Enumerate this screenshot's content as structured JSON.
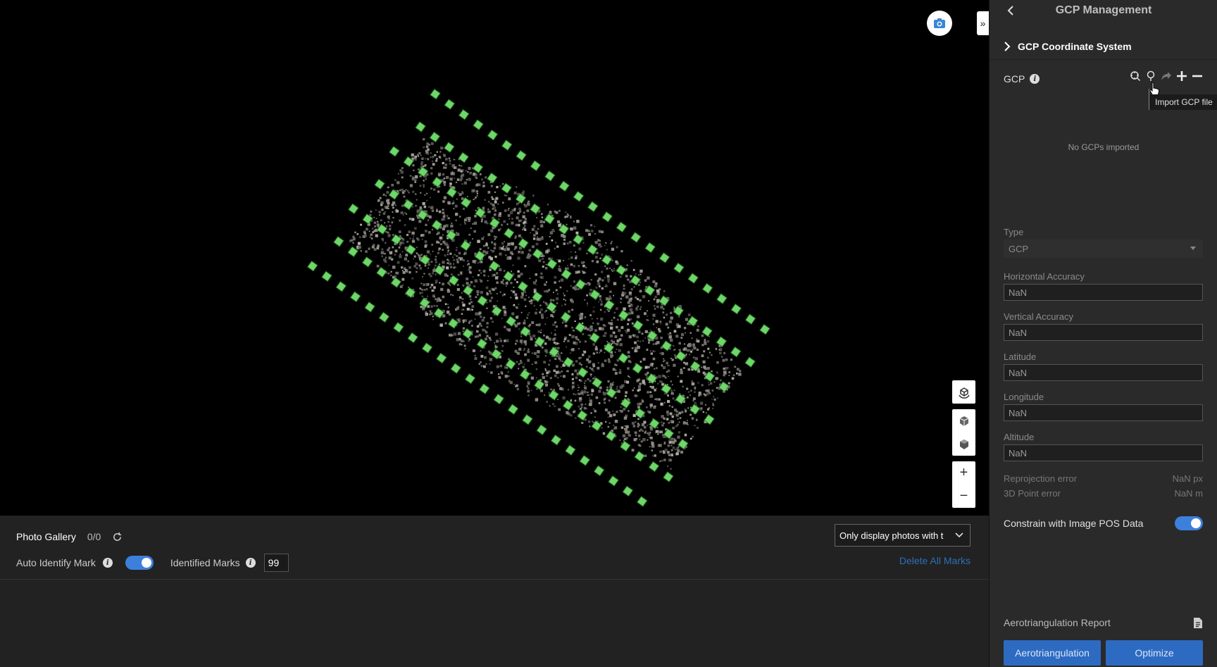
{
  "panel": {
    "title": "GCP Management",
    "coord_section": "GCP Coordinate System",
    "gcp_label": "GCP",
    "tooltip": "Import GCP file",
    "empty_text": "No GCPs imported",
    "type_label": "Type",
    "type_value": "GCP",
    "fields": [
      {
        "label": "Horizontal Accuracy",
        "value": "NaN"
      },
      {
        "label": "Vertical Accuracy",
        "value": "NaN"
      },
      {
        "label": "Latitude",
        "value": "NaN"
      },
      {
        "label": "Longitude",
        "value": "NaN"
      },
      {
        "label": "Altitude",
        "value": "NaN"
      }
    ],
    "reprojection_label": "Reprojection error",
    "reprojection_value": "NaN px",
    "point_error_label": "3D Point error",
    "point_error_value": "NaN m",
    "constrain_label": "Constrain with Image POS Data",
    "constrain_on": true,
    "report_label": "Aerotriangulation Report",
    "aerotriangulation_button": "Aerotriangulation",
    "optimize_button": "Optimize"
  },
  "bottom": {
    "gallery_title": "Photo Gallery",
    "gallery_count": "0/0",
    "auto_identify_label": "Auto Identify Mark",
    "auto_identify_on": true,
    "identified_marks_label": "Identified Marks",
    "identified_marks_value": "99",
    "filter_value": "Only display photos with t",
    "delete_all": "Delete All Marks"
  },
  "viewport": {
    "collapse_glyph": "»",
    "zoom_in": "+",
    "zoom_out": "−"
  },
  "colors": {
    "accent": "#2d6bc2",
    "toggle": "#3c80db",
    "camera_marker": "#6fd66a"
  }
}
